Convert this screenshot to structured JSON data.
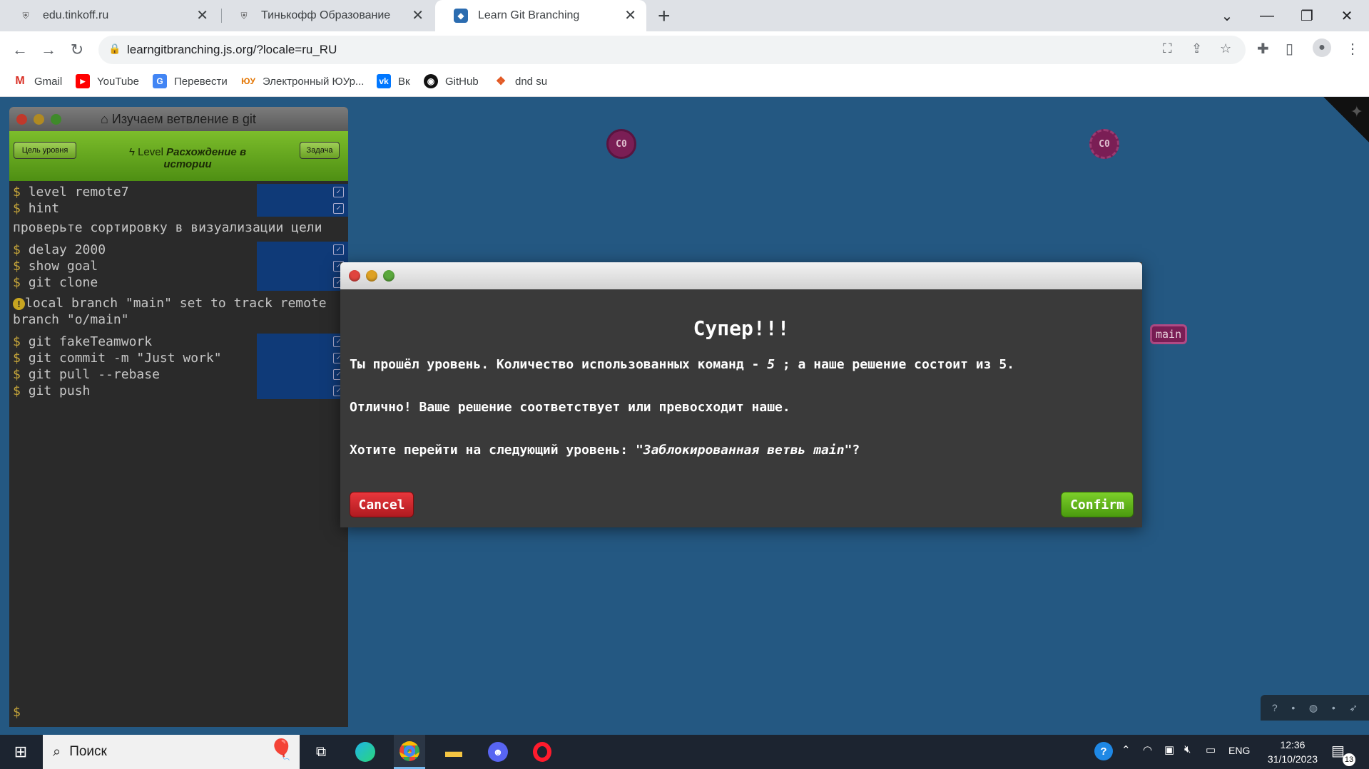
{
  "browser": {
    "tabs": [
      {
        "title": "edu.tinkoff.ru"
      },
      {
        "title": "Тинькофф Образование"
      },
      {
        "title": "Learn Git Branching"
      }
    ],
    "url": "learngitbranching.js.org/?locale=ru_RU",
    "bookmarks": [
      {
        "label": "Gmail"
      },
      {
        "label": "YouTube"
      },
      {
        "label": "Перевести"
      },
      {
        "label": "Электронный ЮУр..."
      },
      {
        "label": "Вк"
      },
      {
        "label": "GitHub"
      },
      {
        "label": "dnd su"
      }
    ]
  },
  "terminal": {
    "title": "Изучаем ветвление в git",
    "goal_button": "Цель уровня",
    "task_button": "Задача",
    "level_prefix": "Level",
    "level_name": "Расхождение в истории",
    "prompt": "$",
    "block1": [
      "level remote7",
      "hint"
    ],
    "hint_output": "проверьте сортировку в визуализации цели",
    "block2": [
      "delay 2000",
      "show goal",
      "git clone"
    ],
    "warn_output": "local branch \"main\" set to track remote branch \"o/main\"",
    "block3": [
      "git fakeTeamwork",
      "git commit -m \"Just work\"",
      "git pull --rebase",
      "git push"
    ]
  },
  "graph": {
    "commit_left": "C0",
    "commit_right": "C0",
    "branch": "main"
  },
  "modal": {
    "heading": "Супер!!!",
    "line1_a": "Ты прошёл уровень. Количество использованных команд - ",
    "line1_n": "5",
    "line1_b": " ; а наше решение состоит из 5.",
    "line2": "Отлично! Ваше решение соответствует или превосходит наше.",
    "line3_a": "Хотите перейти на следующий уровень: ",
    "line3_level": "\"Заблокированная ветвь main\"",
    "line3_b": "?",
    "cancel": "Cancel",
    "confirm": "Confirm"
  },
  "taskbar": {
    "search_label": "Поиск",
    "lang": "ENG",
    "time": "12:36",
    "date": "31/10/2023",
    "notifications": "13"
  }
}
